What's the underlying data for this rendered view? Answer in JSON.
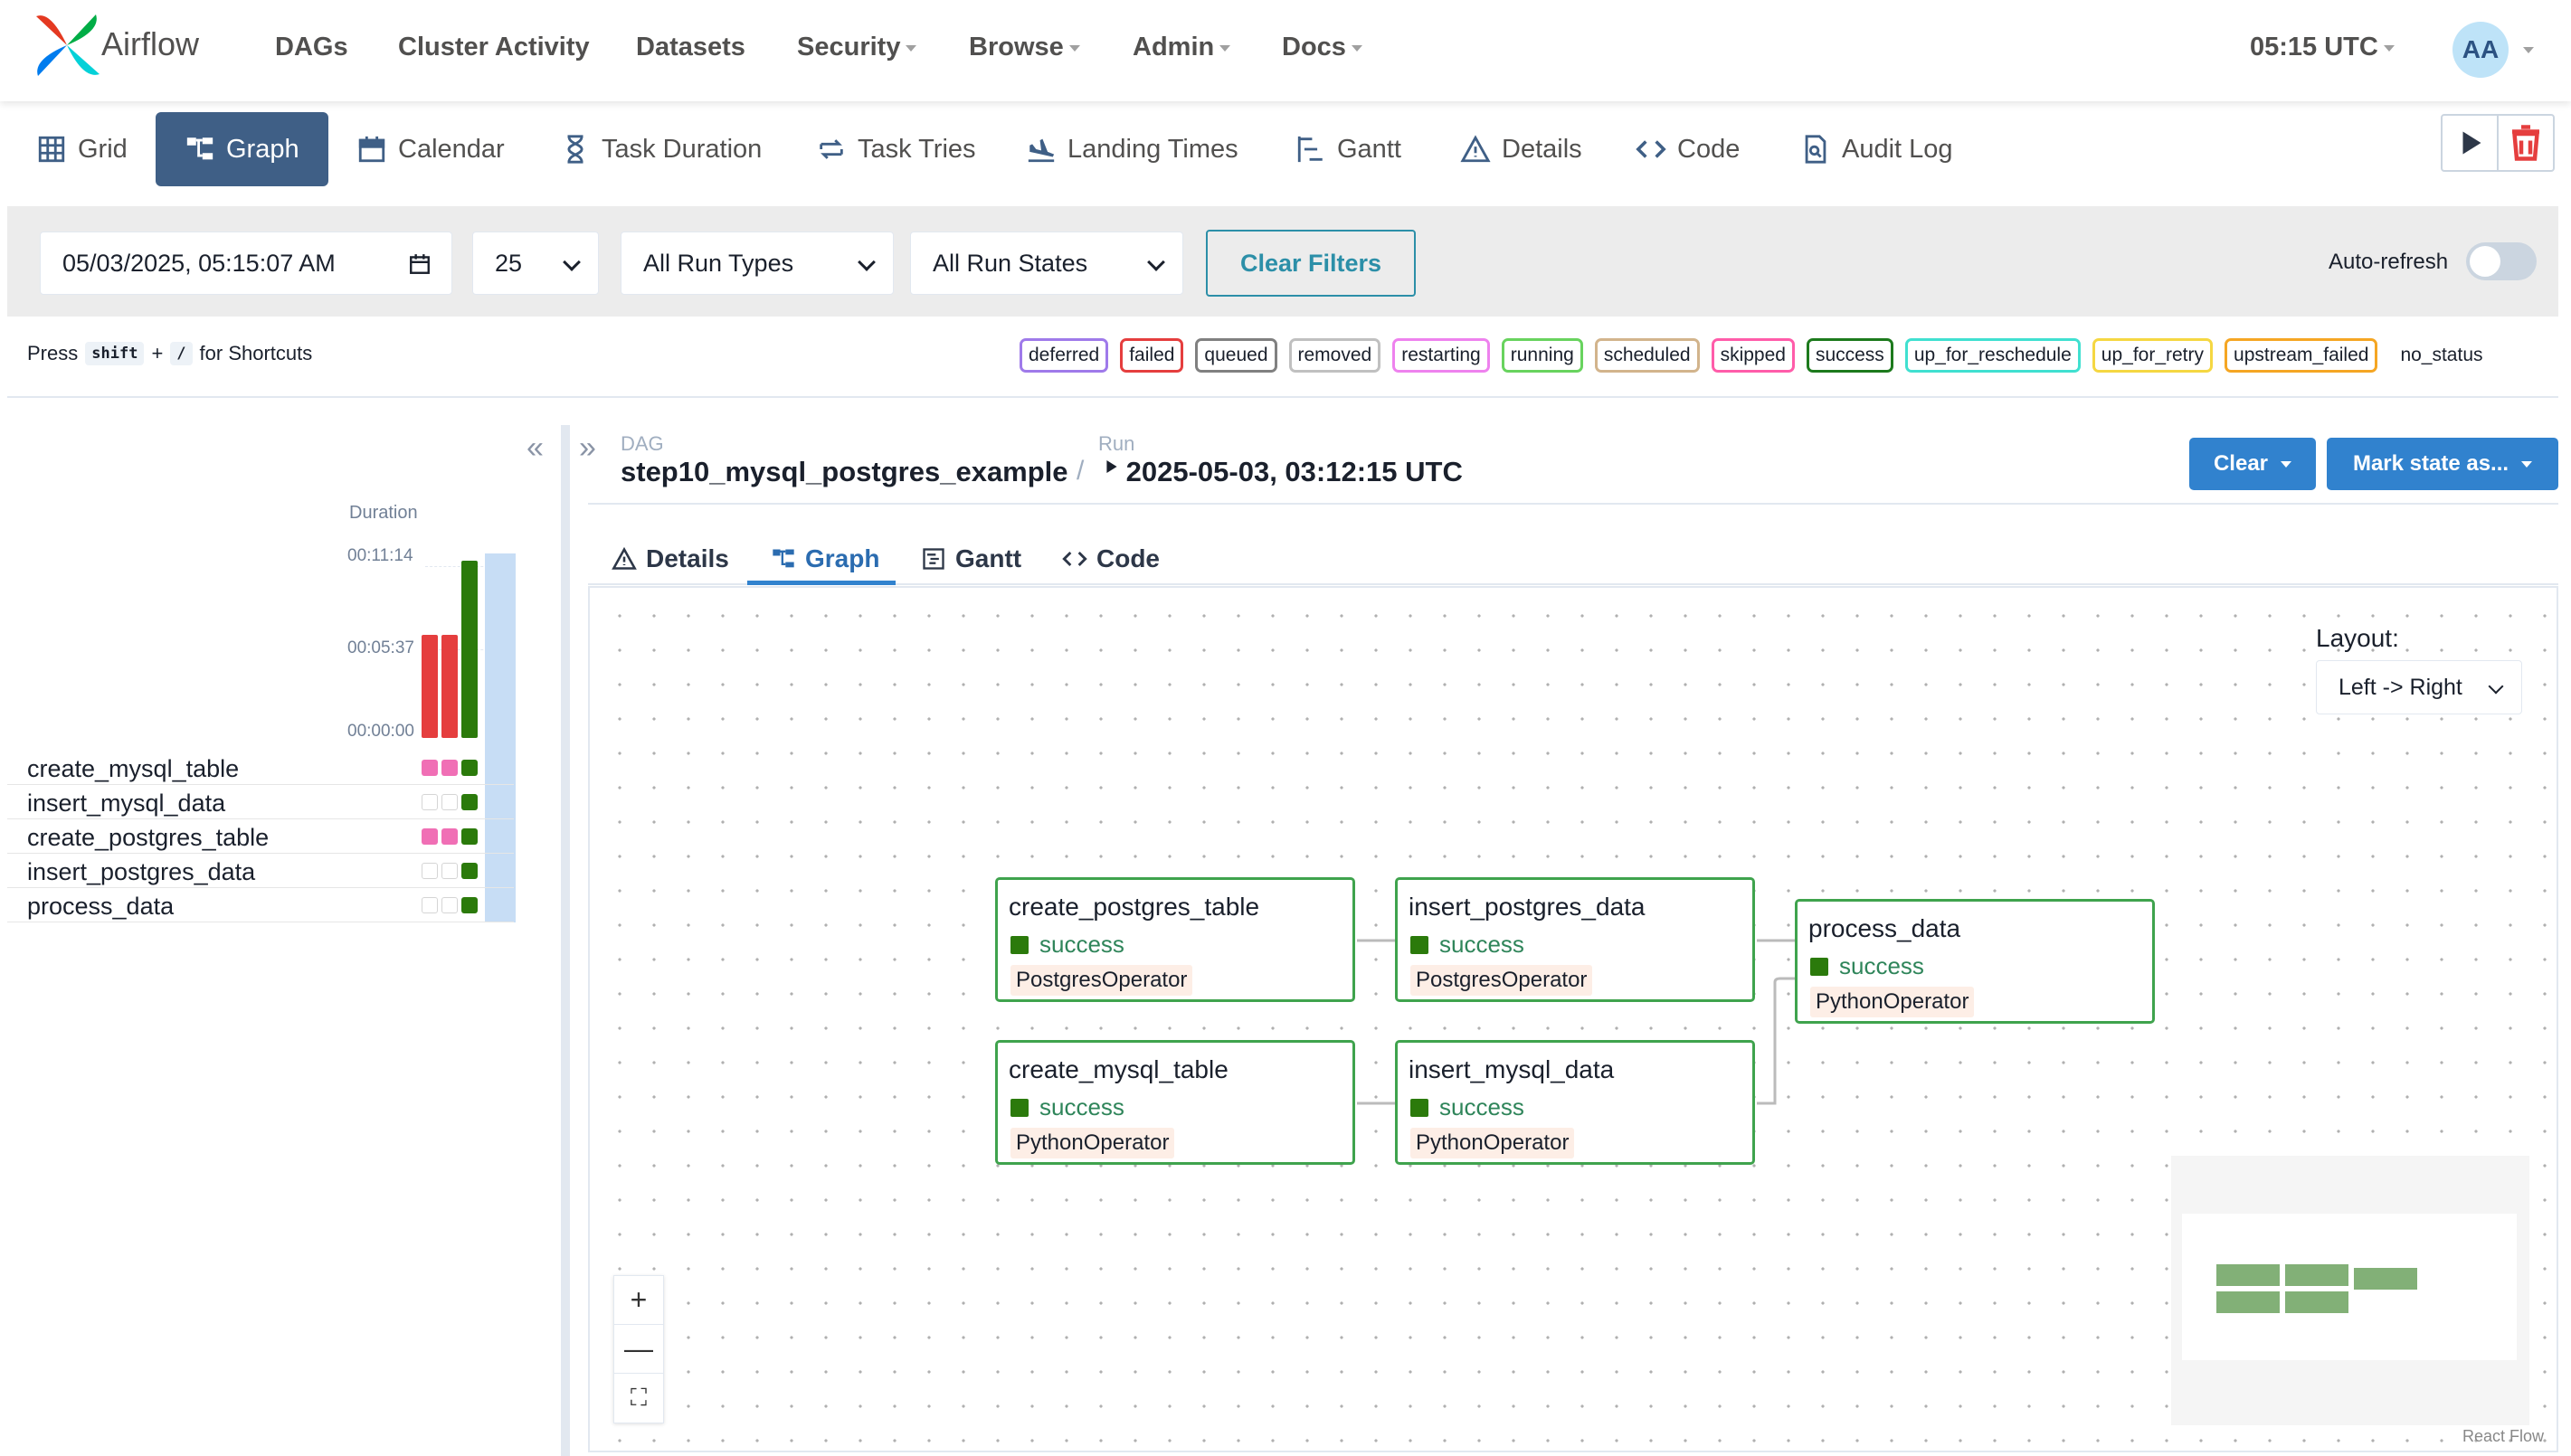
{
  "app": {
    "brand": "Airflow"
  },
  "nav": {
    "items": [
      {
        "label": "DAGs",
        "dropdown": false
      },
      {
        "label": "Cluster Activity",
        "dropdown": false
      },
      {
        "label": "Datasets",
        "dropdown": false
      },
      {
        "label": "Security",
        "dropdown": true
      },
      {
        "label": "Browse",
        "dropdown": true
      },
      {
        "label": "Admin",
        "dropdown": true
      },
      {
        "label": "Docs",
        "dropdown": true
      }
    ],
    "clock": "05:15 UTC",
    "avatar": "AA"
  },
  "view_tabs": [
    {
      "label": "Grid",
      "icon": "grid-icon"
    },
    {
      "label": "Graph",
      "icon": "graph-icon",
      "active": true
    },
    {
      "label": "Calendar",
      "icon": "calendar-icon"
    },
    {
      "label": "Task Duration",
      "icon": "hourglass-icon"
    },
    {
      "label": "Task Tries",
      "icon": "retry-icon"
    },
    {
      "label": "Landing Times",
      "icon": "landing-icon"
    },
    {
      "label": "Gantt",
      "icon": "gantt-icon"
    },
    {
      "label": "Details",
      "icon": "warning-icon"
    },
    {
      "label": "Code",
      "icon": "code-icon"
    },
    {
      "label": "Audit Log",
      "icon": "audit-icon"
    }
  ],
  "filters": {
    "datetime": "05/03/2025, 05:15:07  AM",
    "num_runs": "25",
    "run_types": "All Run Types",
    "run_states": "All Run States",
    "clear_label": "Clear Filters",
    "autorefresh_label": "Auto-refresh",
    "autorefresh_on": false
  },
  "shortcuts": {
    "press": "Press",
    "key1": "shift",
    "plus": "+",
    "key2": "/",
    "suffix": "for Shortcuts"
  },
  "legend": [
    {
      "label": "deferred",
      "color": "#9f7aea"
    },
    {
      "label": "failed",
      "color": "#e53e3e"
    },
    {
      "label": "queued",
      "color": "#808080"
    },
    {
      "label": "removed",
      "color": "#c0c0c0"
    },
    {
      "label": "restarting",
      "color": "#ee82ee"
    },
    {
      "label": "running",
      "color": "#68d35e"
    },
    {
      "label": "scheduled",
      "color": "#d2b48c"
    },
    {
      "label": "skipped",
      "color": "#ff5ca9"
    },
    {
      "label": "success",
      "color": "#1d7a1d"
    },
    {
      "label": "up_for_reschedule",
      "color": "#40e0d0"
    },
    {
      "label": "up_for_retry",
      "color": "#f5d742"
    },
    {
      "label": "upstream_failed",
      "color": "#f5a623"
    },
    {
      "label": "no_status",
      "color": ""
    }
  ],
  "grid": {
    "duration_label": "Duration",
    "y_ticks": [
      "00:11:14",
      "00:05:37",
      "00:00:00"
    ],
    "tasks": [
      {
        "name": "create_mysql_table",
        "cells": [
          "skipped",
          "skipped",
          "success"
        ]
      },
      {
        "name": "insert_mysql_data",
        "cells": [
          "none",
          "none",
          "success"
        ]
      },
      {
        "name": "create_postgres_table",
        "cells": [
          "skipped",
          "skipped",
          "success"
        ]
      },
      {
        "name": "insert_postgres_data",
        "cells": [
          "none",
          "none",
          "success"
        ]
      },
      {
        "name": "process_data",
        "cells": [
          "none",
          "none",
          "success"
        ]
      }
    ],
    "runs": [
      {
        "state": "failed",
        "duration_fraction": 0.58
      },
      {
        "state": "failed",
        "duration_fraction": 0.58
      },
      {
        "state": "success",
        "duration_fraction": 1.0
      }
    ]
  },
  "breadcrumb": {
    "dag_label": "DAG",
    "dag_id": "step10_mysql_postgres_example",
    "sep": "/",
    "run_label": "Run",
    "run_id": "2025-05-03, 03:12:15 UTC"
  },
  "actions": {
    "clear": "Clear",
    "mark_state": "Mark state as..."
  },
  "detail_tabs": [
    {
      "label": "Details",
      "icon": "warning-icon"
    },
    {
      "label": "Graph",
      "icon": "graph-icon",
      "active": true
    },
    {
      "label": "Gantt",
      "icon": "gantt-icon"
    },
    {
      "label": "Code",
      "icon": "code-icon"
    }
  ],
  "graph": {
    "layout_label": "Layout:",
    "layout_value": "Left -> Right",
    "nodes": [
      {
        "id": "create_postgres_table",
        "state": "success",
        "operator": "PostgresOperator"
      },
      {
        "id": "insert_postgres_data",
        "state": "success",
        "operator": "PostgresOperator"
      },
      {
        "id": "process_data",
        "state": "success",
        "operator": "PythonOperator"
      },
      {
        "id": "create_mysql_table",
        "state": "success",
        "operator": "PythonOperator"
      },
      {
        "id": "insert_mysql_data",
        "state": "success",
        "operator": "PythonOperator"
      }
    ],
    "zoom": {
      "in": "+",
      "out": "—",
      "fit": "⛶"
    },
    "attribution": "React Flow"
  },
  "colors": {
    "success": "#2b7a0b",
    "failed": "#e53e3e",
    "skipped": "#f06fb5",
    "accent": "#3182ce",
    "active_tab": "#3f5f86"
  }
}
